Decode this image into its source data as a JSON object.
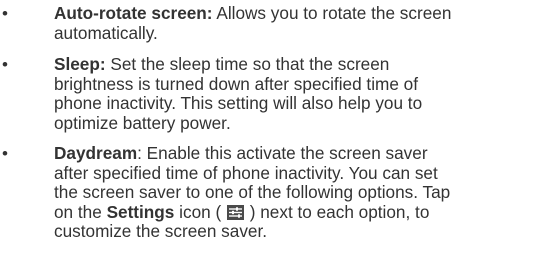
{
  "bullet_symbol": "•",
  "items": [
    {
      "term": "Auto-rotate screen:",
      "line1_rest": " Allows you to rotate the screen",
      "line2": "automatically."
    },
    {
      "term": "Sleep:",
      "line1_rest": " Set the sleep time so that the screen",
      "line2": "brightness is turned down after specified time of",
      "line3": "phone inactivity. This setting will also help you to",
      "line4": "optimize battery power."
    },
    {
      "term": "Daydream",
      "line1_rest": ": Enable this activate the screen saver",
      "line2": "after specified time of phone inactivity. You can set",
      "line3": "the screen saver to one of the following options. Tap",
      "line4_pre": "on the ",
      "line4_bold": "Settings",
      "line4_mid": " icon (",
      "line4_post": ") next to each option, to",
      "line5": "customize the screen saver.",
      "icon": "settings-sliders-icon"
    }
  ]
}
